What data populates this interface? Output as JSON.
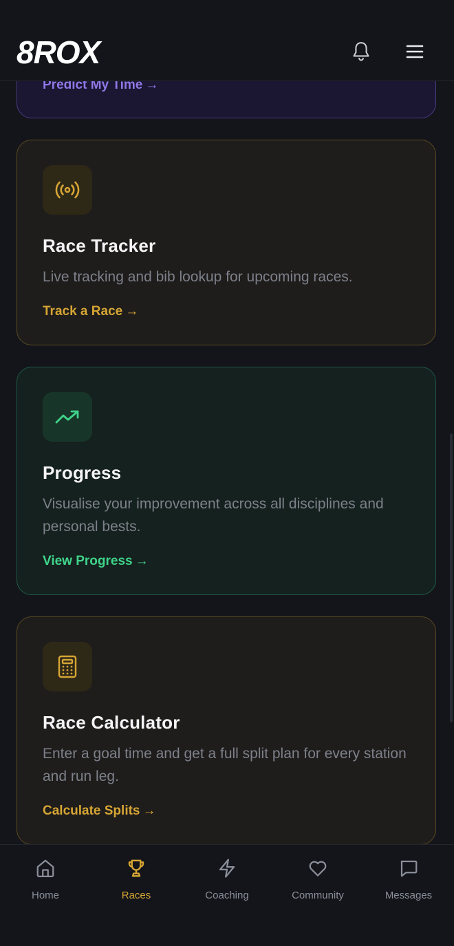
{
  "app": {
    "logo_text": "8ROX"
  },
  "previous_card": {
    "cta_label": "Predict My Time",
    "cta_arrow": "→"
  },
  "cards": [
    {
      "icon": "broadcast-signal-icon",
      "title": "Race Tracker",
      "description": "Live tracking and bib lookup for upcoming races.",
      "cta_label": "Track a Race",
      "cta_arrow": "→",
      "accent": "#d6a534"
    },
    {
      "icon": "trending-up-icon",
      "title": "Progress",
      "description": "Visualise your improvement across all disciplines and personal bests.",
      "cta_label": "View Progress",
      "cta_arrow": "→",
      "accent": "#3fd48b"
    },
    {
      "icon": "calculator-icon",
      "title": "Race Calculator",
      "description": "Enter a goal time and get a full split plan for every station and run leg.",
      "cta_label": "Calculate Splits",
      "cta_arrow": "→",
      "accent": "#d6a534"
    }
  ],
  "bottom_nav": {
    "active": "Races",
    "items": [
      {
        "label": "Home",
        "icon": "home-icon"
      },
      {
        "label": "Races",
        "icon": "trophy-icon"
      },
      {
        "label": "Coaching",
        "icon": "lightning-icon"
      },
      {
        "label": "Community",
        "icon": "heart-icon"
      },
      {
        "label": "Messages",
        "icon": "message-icon"
      }
    ]
  },
  "colors": {
    "background": "#13151a",
    "accent_amber": "#d6a534",
    "accent_green": "#3fd48b",
    "accent_purple": "#8e78e6",
    "muted_text": "#7c808a"
  }
}
